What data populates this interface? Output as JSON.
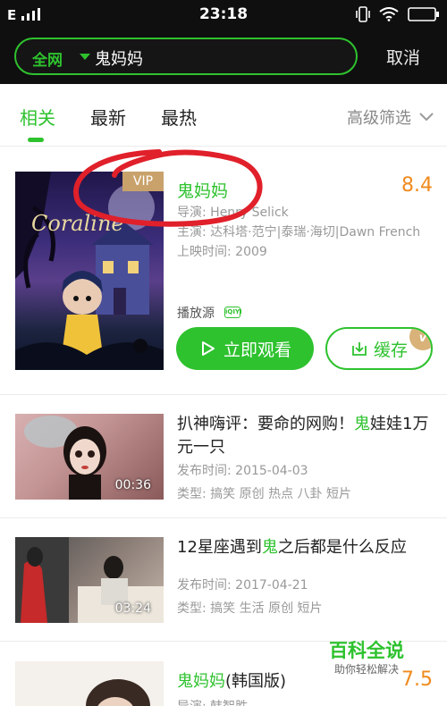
{
  "status": {
    "carrier": "E",
    "time": "23:18"
  },
  "search": {
    "scope": "全网",
    "query": "鬼妈妈",
    "cancel": "取消"
  },
  "tabs": [
    {
      "label": "相关",
      "active": true
    },
    {
      "label": "最新",
      "active": false
    },
    {
      "label": "最热",
      "active": false
    }
  ],
  "filter_label": "高级筛选",
  "movie": {
    "poster_text": "Coraline",
    "vip": "VIP",
    "title": "鬼妈妈",
    "score": "8.4",
    "director": "导演: Henry Selick",
    "cast": "主演: 达科塔·范宁|泰瑞·海切|Dawn French",
    "release": "上映时间: 2009",
    "source_label": "播放源",
    "source_icon": "iQIYI",
    "watch": "立即观看",
    "cache": "缓存",
    "cache_badge": "v"
  },
  "videos": [
    {
      "title_before": "扒神嗨评：要命的网购！",
      "title_highlight": "鬼",
      "title_after": "娃娃1万元一只",
      "duration": "00:36",
      "date": "发布时间: 2015-04-03",
      "tags": "类型: 搞笑 原创 热点 八卦 短片"
    },
    {
      "title_before": "12星座遇到",
      "title_highlight": "鬼",
      "title_after": "之后都是什么反应",
      "duration": "03:24",
      "date": "发布时间: 2017-04-21",
      "tags": "类型: 搞笑 生活 原创 短片"
    }
  ],
  "partial": {
    "title_highlight": "鬼妈妈",
    "title_after": "(韩国版)",
    "score": "7.5",
    "director": "导演: 韩智胜"
  },
  "watermark": {
    "main": "百科全说",
    "sub": "助你轻松解决"
  },
  "colors": {
    "accent": "#2ec22e",
    "score": "#f08a1c",
    "vip": "#c9a26b",
    "annotation": "#e0202a"
  }
}
